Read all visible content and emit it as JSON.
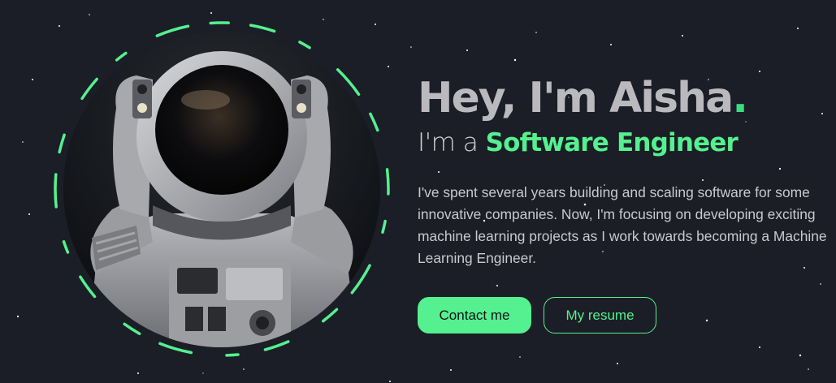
{
  "hero": {
    "greeting": "Hey, I'm Aisha",
    "greeting_punct": ".",
    "role_prefix": "I'm a ",
    "role": "Software Engineer",
    "bio": "I've spent several years building and scaling software for some innovative companies. Now, I'm focusing on developing exciting machine learning projects as I work towards becoming a Machine Learning Engineer."
  },
  "buttons": {
    "contact_label": "Contact me",
    "resume_label": "My resume"
  },
  "avatar": {
    "icon": "astronaut-illustration"
  },
  "colors": {
    "background": "#1b1e26",
    "accent": "#55f08f",
    "headline": "#b9b9be",
    "text": "#c9cacf"
  }
}
